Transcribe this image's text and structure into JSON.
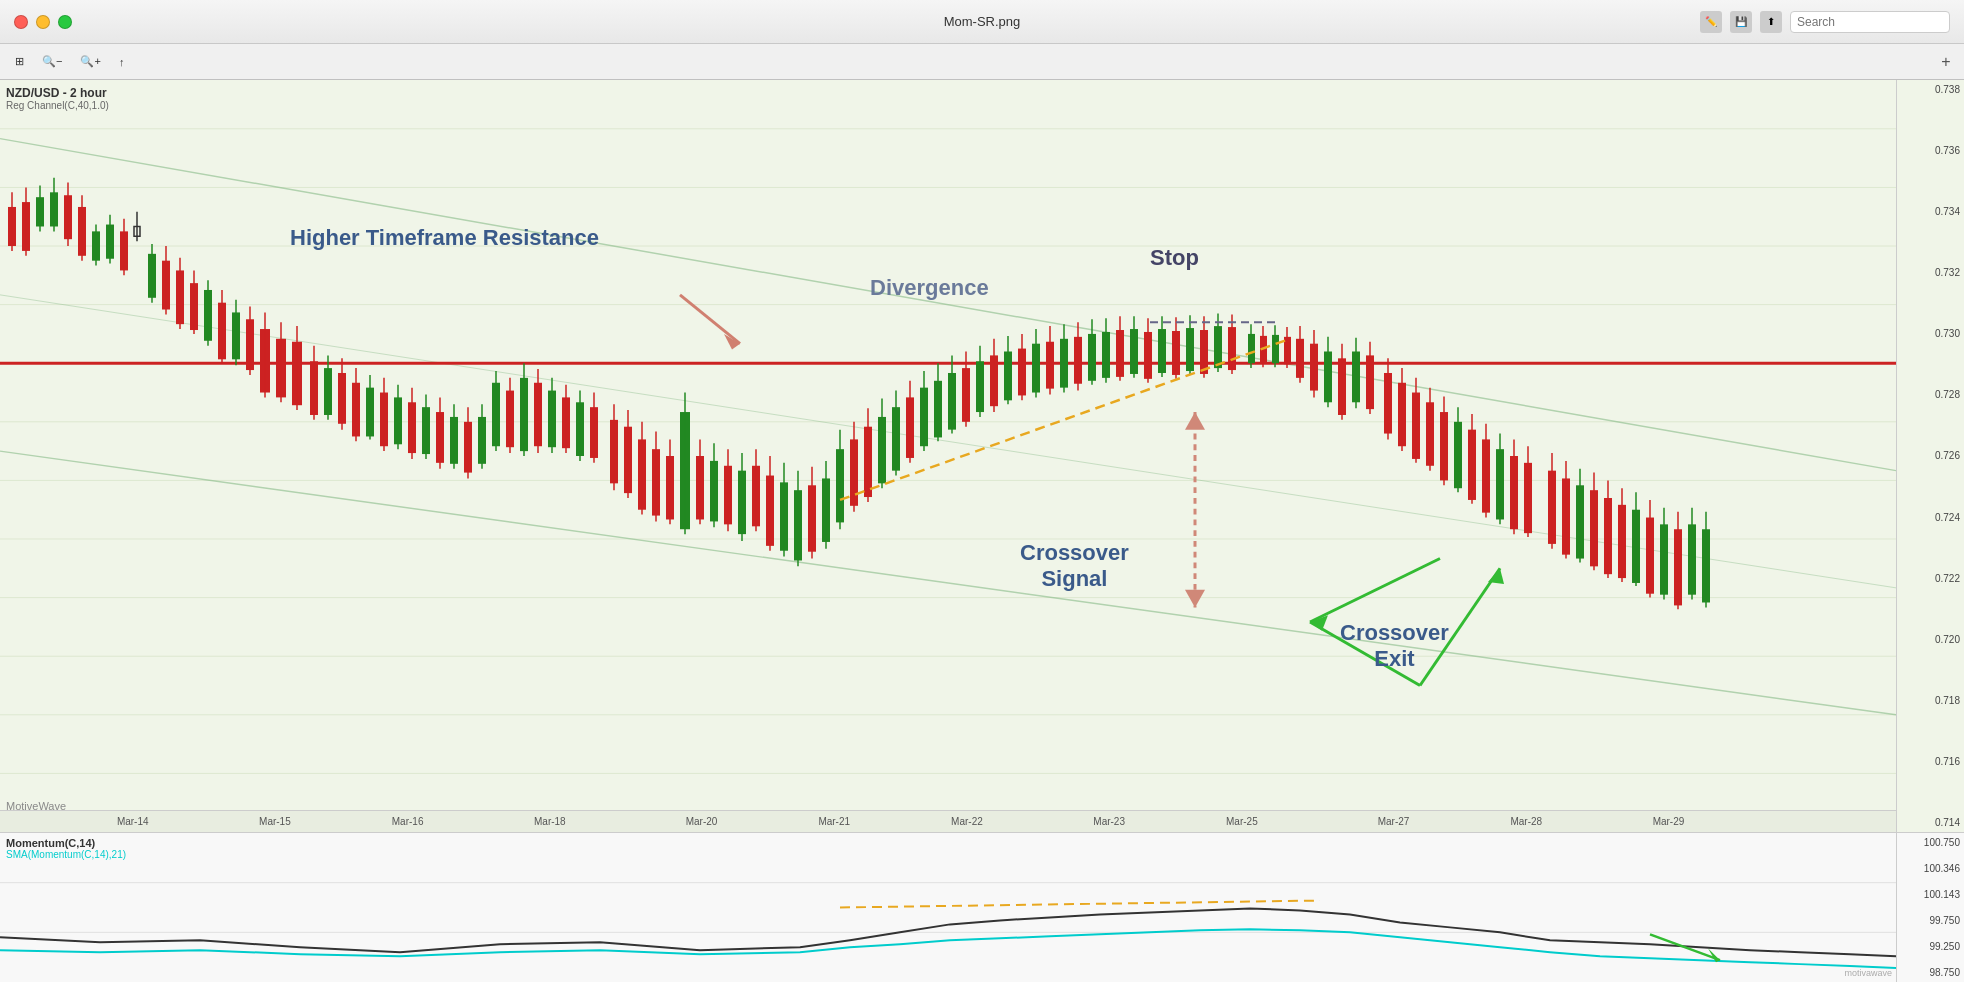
{
  "titlebar": {
    "title": "Mom-SR.png",
    "search_placeholder": "Search"
  },
  "toolbar": {
    "view_label": "⊞",
    "zoom_out_label": "−",
    "zoom_in_label": "+",
    "export_label": "↑",
    "plus_label": "+"
  },
  "chart": {
    "symbol": "NZD/USD - 2 hour",
    "indicator": "Reg Channel(C,40,1.0)",
    "watermark": "MotiveWave",
    "sub_indicator": "Momentum(C,14)",
    "sub_indicator2": "SMA(Momentum(C,14),21)",
    "annotations": {
      "resistance": "Higher Timeframe Resistance",
      "divergence": "Divergence",
      "stop": "Stop",
      "crossover_signal": "Crossover\nSignal",
      "crossover_exit": "Crossover\nExit"
    },
    "price_levels": [
      "0.738",
      "0.736",
      "0.734",
      "0.732",
      "0.730",
      "0.728",
      "0.726",
      "0.724",
      "0.722",
      "0.720",
      "0.718",
      "0.716",
      "0.714"
    ],
    "date_labels": [
      "Mar-14",
      "Mar-15",
      "Mar-16",
      "Mar-18",
      "Mar-20",
      "Mar-21",
      "Mar-22",
      "Mar-23",
      "Mar-25",
      "Mar-27",
      "Mar-28",
      "Mar-29"
    ],
    "sub_price_levels": [
      "100.750",
      "100.346",
      "100.143",
      "99.750",
      "99.250",
      "98.750"
    ]
  }
}
